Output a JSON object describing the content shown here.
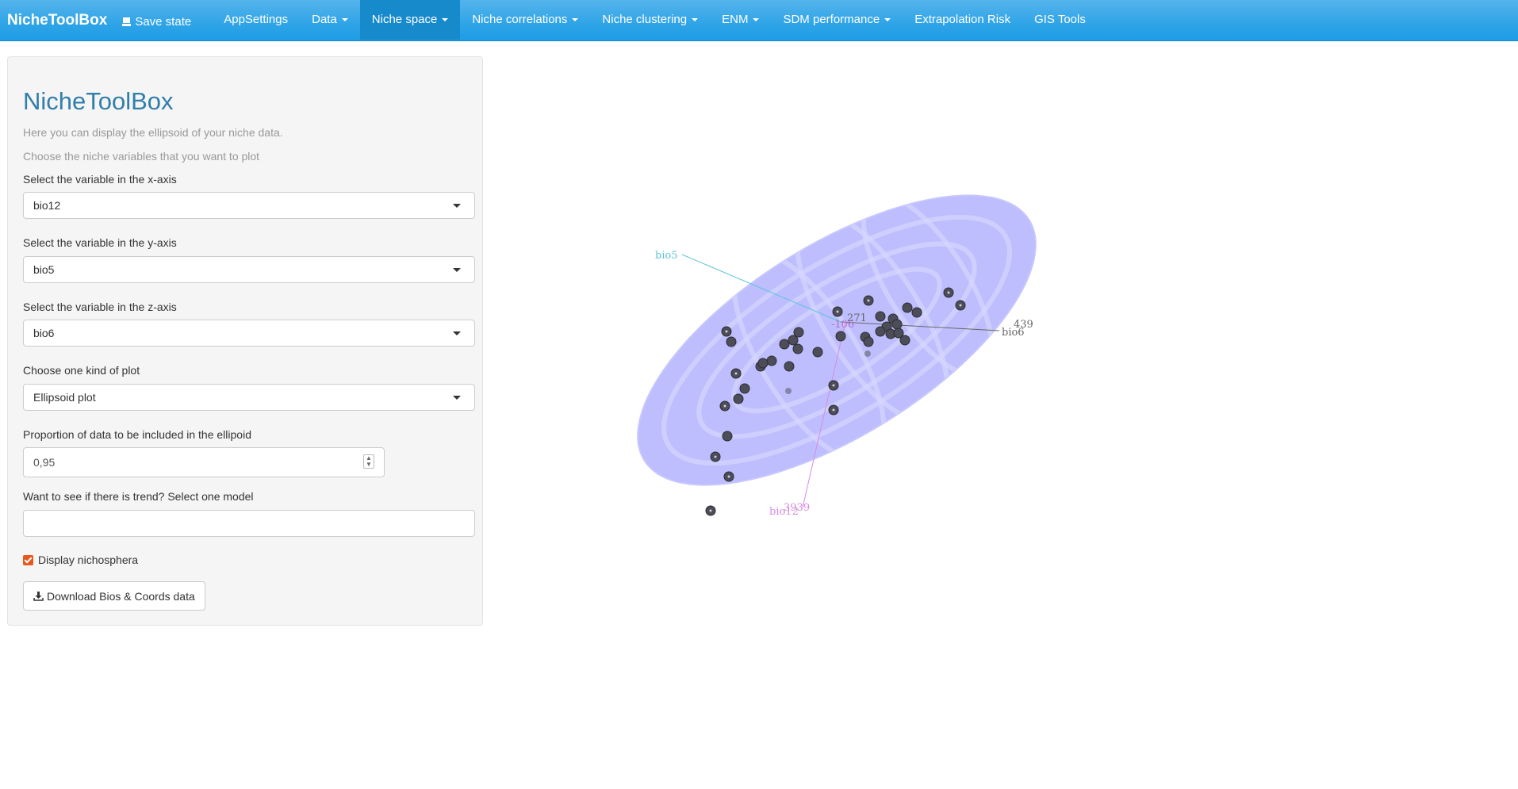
{
  "navbar": {
    "brand": "NicheToolBox",
    "save_state": "Save state",
    "items": [
      {
        "label": "AppSettings"
      },
      {
        "label": "Data"
      },
      {
        "label": "Niche space"
      },
      {
        "label": "Niche correlations"
      },
      {
        "label": "Niche clustering"
      },
      {
        "label": "ENM"
      },
      {
        "label": "SDM performance"
      },
      {
        "label": "Extrapolation Risk"
      },
      {
        "label": "GIS Tools"
      }
    ]
  },
  "sidebar": {
    "title": "NicheToolBox",
    "help1": "Here you can display the ellipsoid of your niche data.",
    "help2": "Choose the niche variables that you want to plot",
    "x_label": "Select the variable in the x-axis",
    "x_value": "bio12",
    "y_label": "Select the variable in the y-axis",
    "y_value": "bio5",
    "z_label": "Select the variable in the z-axis",
    "z_value": "bio6",
    "plot_label": "Choose one kind of plot",
    "plot_value": "Ellipsoid plot",
    "prop_label": "Proportion of data to be included in the ellipoid",
    "prop_value": "0,95",
    "trend_label": "Want to see if there is trend? Select one model",
    "trend_value": "",
    "nichosphera_label": "Display nichosphera",
    "download_label": "Download Bios & Coords data"
  },
  "plot": {
    "ellipsoid_color": "#b3b3ff",
    "axis_labels": {
      "x": "bio12",
      "y": "bio5",
      "z": "bio6"
    },
    "tick_labels": [
      "3939",
      "271",
      "-106",
      "439"
    ]
  }
}
